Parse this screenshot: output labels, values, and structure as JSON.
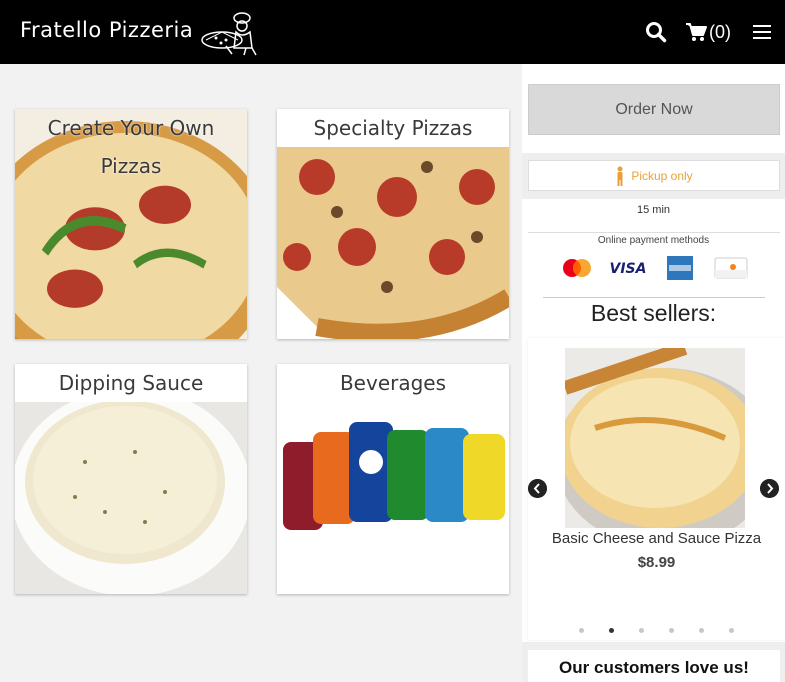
{
  "header": {
    "brand": "Fratello Pizzeria",
    "cart_count": "(0)"
  },
  "categories": [
    {
      "title": "Create Your Own Pizzas"
    },
    {
      "title": "Specialty Pizzas"
    },
    {
      "title": "Dipping Sauce"
    },
    {
      "title": "Beverages"
    }
  ],
  "sidebar": {
    "order_button": "Order Now",
    "pickup_label": "Pickup only",
    "time": "15 min",
    "payment_label": "Online payment methods",
    "payment_icons": [
      "mastercard-icon",
      "visa-icon",
      "amex-icon",
      "discover-icon"
    ],
    "best_sellers_title": "Best sellers:",
    "slide": {
      "name": "Basic Cheese and Sauce Pizza",
      "price": "$8.99"
    },
    "carousel_pages": 6,
    "carousel_active": 2,
    "love_title": "Our customers love us!"
  },
  "colors": {
    "header_bg": "#000000",
    "pickup_accent": "#e8a13a",
    "order_button_bg": "#d9d9d9"
  }
}
